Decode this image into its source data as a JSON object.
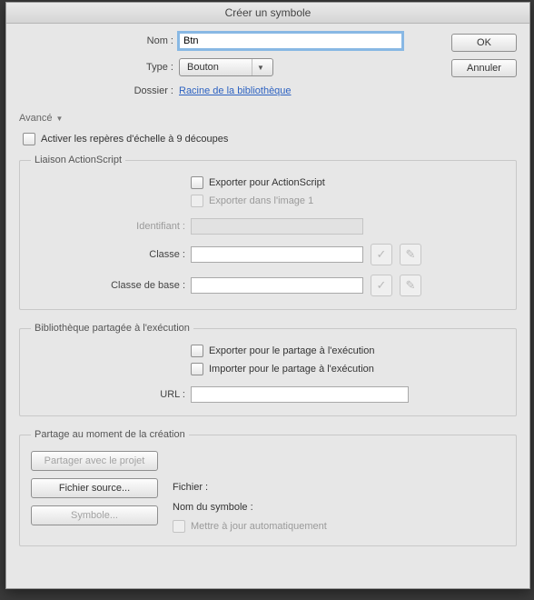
{
  "title": "Créer un symbole",
  "buttons": {
    "ok": "OK",
    "cancel": "Annuler"
  },
  "top": {
    "name_label": "Nom :",
    "name_value": "Btn",
    "type_label": "Type :",
    "type_value": "Bouton",
    "folder_label": "Dossier :",
    "folder_link": "Racine de la bibliothèque"
  },
  "advanced_label": "Avancé",
  "scale9": {
    "label": "Activer les repères d'échelle à 9 découpes"
  },
  "linkage": {
    "legend": "Liaison ActionScript",
    "export_as": "Exporter pour ActionScript",
    "export_frame1": "Exporter dans l'image 1",
    "id_label": "Identifiant :",
    "class_label": "Classe :",
    "baseclass_label": "Classe de base :",
    "class_value": "",
    "baseclass_value": ""
  },
  "runtimeShare": {
    "legend": "Bibliothèque partagée à l'exécution",
    "export_label": "Exporter pour le partage à l'exécution",
    "import_label": "Importer pour le partage à l'exécution",
    "url_label": "URL :",
    "url_value": ""
  },
  "authorShare": {
    "legend": "Partage au moment de la création",
    "share_project": "Partager avec le projet",
    "source_file": "Fichier source...",
    "symbol": "Symbole...",
    "file_label": "Fichier :",
    "symbol_name_label": "Nom du symbole :",
    "auto_update": "Mettre à jour automatiquement"
  }
}
